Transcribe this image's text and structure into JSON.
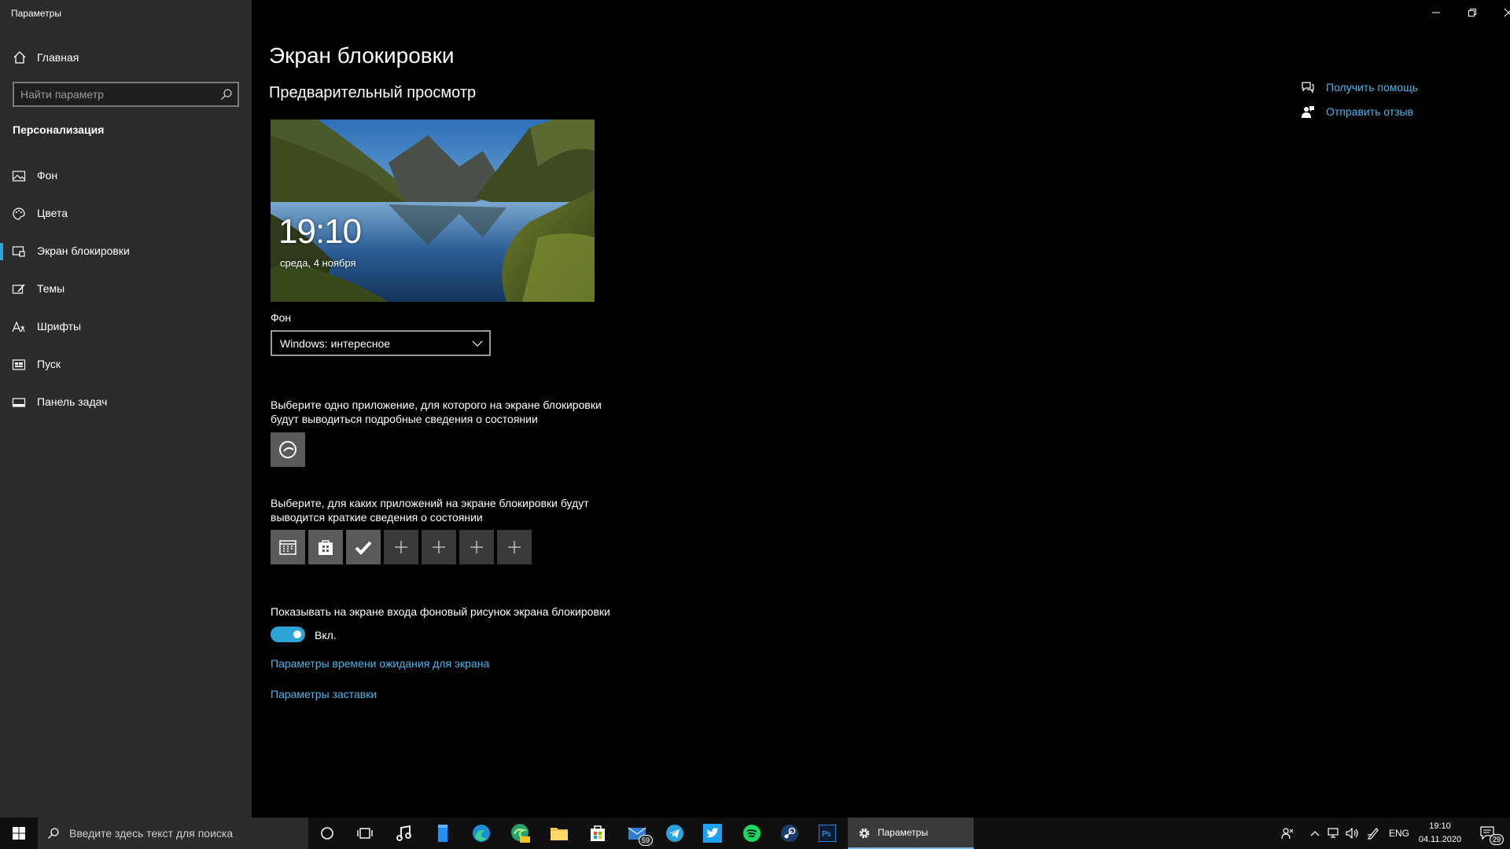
{
  "window": {
    "title": "Параметры"
  },
  "sidebar": {
    "home_label": "Главная",
    "search_placeholder": "Найти параметр",
    "section_title": "Персонализация",
    "items": [
      {
        "label": "Фон",
        "icon": "picture-icon"
      },
      {
        "label": "Цвета",
        "icon": "palette-icon"
      },
      {
        "label": "Экран блокировки",
        "icon": "lock-screen-icon",
        "active": true
      },
      {
        "label": "Темы",
        "icon": "brush-icon"
      },
      {
        "label": "Шрифты",
        "icon": "font-icon"
      },
      {
        "label": "Пуск",
        "icon": "start-icon"
      },
      {
        "label": "Панель задач",
        "icon": "taskbar-icon"
      }
    ]
  },
  "main": {
    "title": "Экран блокировки",
    "preview_heading": "Предварительный просмотр",
    "preview": {
      "time": "19:10",
      "date": "среда, 4 ноября"
    },
    "background_label": "Фон",
    "background_value": "Windows: интересное",
    "detailed_status_text": "Выберите одно приложение, для которого на экране блокировки будут выводиться подробные сведения о состоянии",
    "quick_status_text": "Выберите, для каких приложений на экране блокировки будут выводится краткие сведения о состоянии",
    "quick_status_tiles": [
      "calendar-icon",
      "store-icon",
      "check-icon",
      "plus-icon",
      "plus-icon",
      "plus-icon",
      "plus-icon"
    ],
    "signin_bg_label": "Показывать на экране входа фоновый рисунок экрана блокировки",
    "toggle_state": "Вкл.",
    "link_timeout": "Параметры времени ожидания для экрана",
    "link_screensaver": "Параметры заставки",
    "help_link": "Получить помощь",
    "feedback_link": "Отправить отзыв"
  },
  "taskbar": {
    "search_placeholder": "Введите здесь текст для поиска",
    "mail_badge": "59",
    "active_app": "Параметры",
    "language": "ENG",
    "time": "19:10",
    "date": "04.11.2020",
    "notifications": "29"
  },
  "colors": {
    "accent": "#2ea3d8",
    "link": "#4cb4ea",
    "sidebar_bg": "#2b2b2b",
    "main_bg": "#000000"
  }
}
